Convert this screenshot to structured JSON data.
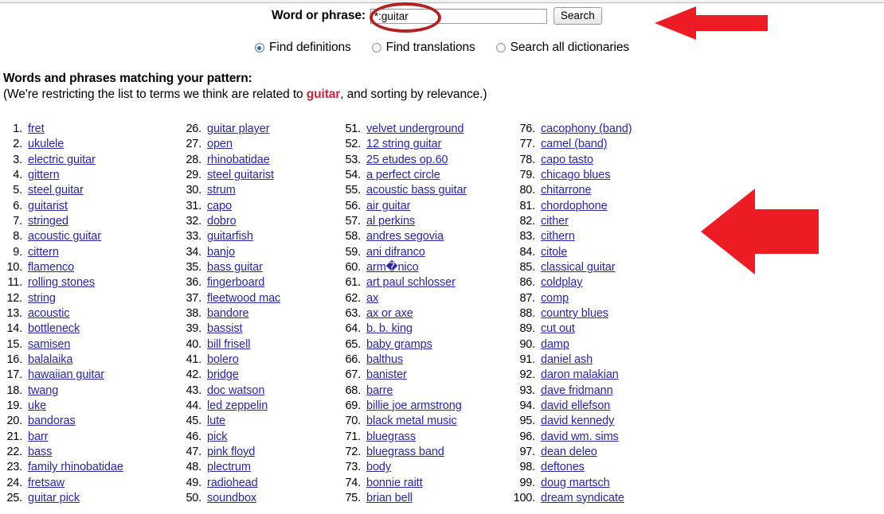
{
  "search": {
    "label": "Word or phrase:",
    "value": "*:guitar",
    "placeholder": "",
    "button_label": "Search"
  },
  "modes": [
    {
      "label": "Find definitions",
      "selected": true
    },
    {
      "label": "Find translations",
      "selected": false
    },
    {
      "label": "Search all dictionaries",
      "selected": false
    }
  ],
  "results": {
    "heading": "Words and phrases matching your pattern:",
    "note_prefix": "(We're restricting the list to terms we think are related to ",
    "note_keyword": "guitar",
    "note_suffix": ", and sorting by relevance.)",
    "columns": [
      {
        "items": [
          {
            "num": "1.",
            "label": "fret"
          },
          {
            "num": "2.",
            "label": "ukulele"
          },
          {
            "num": "3.",
            "label": "electric guitar"
          },
          {
            "num": "4.",
            "label": "gittern"
          },
          {
            "num": "5.",
            "label": "steel guitar"
          },
          {
            "num": "6.",
            "label": "guitarist"
          },
          {
            "num": "7.",
            "label": "stringed"
          },
          {
            "num": "8.",
            "label": "acoustic guitar"
          },
          {
            "num": "9.",
            "label": "cittern"
          },
          {
            "num": "10.",
            "label": "flamenco"
          },
          {
            "num": "11.",
            "label": "rolling stones"
          },
          {
            "num": "12.",
            "label": "string"
          },
          {
            "num": "13.",
            "label": "acoustic"
          },
          {
            "num": "14.",
            "label": "bottleneck"
          },
          {
            "num": "15.",
            "label": "samisen"
          },
          {
            "num": "16.",
            "label": "balalaika"
          },
          {
            "num": "17.",
            "label": "hawaiian guitar"
          },
          {
            "num": "18.",
            "label": "twang"
          },
          {
            "num": "19.",
            "label": "uke"
          },
          {
            "num": "20.",
            "label": "bandoras"
          },
          {
            "num": "21.",
            "label": "barr"
          },
          {
            "num": "22.",
            "label": "bass"
          },
          {
            "num": "23.",
            "label": "family rhinobatidae"
          },
          {
            "num": "24.",
            "label": "fretsaw"
          },
          {
            "num": "25.",
            "label": "guitar pick"
          }
        ]
      },
      {
        "items": [
          {
            "num": "26.",
            "label": "guitar player"
          },
          {
            "num": "27.",
            "label": "open"
          },
          {
            "num": "28.",
            "label": "rhinobatidae"
          },
          {
            "num": "29.",
            "label": "steel guitarist"
          },
          {
            "num": "30.",
            "label": "strum"
          },
          {
            "num": "31.",
            "label": "capo"
          },
          {
            "num": "32.",
            "label": "dobro"
          },
          {
            "num": "33.",
            "label": "guitarfish"
          },
          {
            "num": "34.",
            "label": "banjo"
          },
          {
            "num": "35.",
            "label": "bass guitar"
          },
          {
            "num": "36.",
            "label": "fingerboard"
          },
          {
            "num": "37.",
            "label": "fleetwood mac"
          },
          {
            "num": "38.",
            "label": "bandore"
          },
          {
            "num": "39.",
            "label": "bassist"
          },
          {
            "num": "40.",
            "label": "bill frisell"
          },
          {
            "num": "41.",
            "label": "bolero"
          },
          {
            "num": "42.",
            "label": "bridge"
          },
          {
            "num": "43.",
            "label": "doc watson"
          },
          {
            "num": "44.",
            "label": "led zeppelin"
          },
          {
            "num": "45.",
            "label": "lute"
          },
          {
            "num": "46.",
            "label": "pick"
          },
          {
            "num": "47.",
            "label": "pink floyd"
          },
          {
            "num": "48.",
            "label": "plectrum"
          },
          {
            "num": "49.",
            "label": "radiohead"
          },
          {
            "num": "50.",
            "label": "soundbox"
          }
        ]
      },
      {
        "items": [
          {
            "num": "51.",
            "label": "velvet underground"
          },
          {
            "num": "52.",
            "label": "12 string guitar"
          },
          {
            "num": "53.",
            "label": "25 etudes op.60"
          },
          {
            "num": "54.",
            "label": "a perfect circle"
          },
          {
            "num": "55.",
            "label": "acoustic bass guitar"
          },
          {
            "num": "56.",
            "label": "air guitar"
          },
          {
            "num": "57.",
            "label": "al perkins"
          },
          {
            "num": "58.",
            "label": "andres segovia"
          },
          {
            "num": "59.",
            "label": "ani difranco"
          },
          {
            "num": "60.",
            "label": "arm�nico"
          },
          {
            "num": "61.",
            "label": "art paul schlosser"
          },
          {
            "num": "62.",
            "label": "ax"
          },
          {
            "num": "63.",
            "label": "ax or axe"
          },
          {
            "num": "64.",
            "label": "b. b. king"
          },
          {
            "num": "65.",
            "label": "baby gramps"
          },
          {
            "num": "66.",
            "label": "balthus"
          },
          {
            "num": "67.",
            "label": "banister"
          },
          {
            "num": "68.",
            "label": "barre"
          },
          {
            "num": "69.",
            "label": "billie joe armstrong"
          },
          {
            "num": "70.",
            "label": "black metal music"
          },
          {
            "num": "71.",
            "label": "bluegrass"
          },
          {
            "num": "72.",
            "label": "bluegrass band"
          },
          {
            "num": "73.",
            "label": "body"
          },
          {
            "num": "74.",
            "label": "bonnie raitt"
          },
          {
            "num": "75.",
            "label": "brian bell"
          }
        ]
      },
      {
        "items": [
          {
            "num": "76.",
            "label": "cacophony (band)"
          },
          {
            "num": "77.",
            "label": "camel (band)"
          },
          {
            "num": "78.",
            "label": "capo tasto"
          },
          {
            "num": "79.",
            "label": "chicago blues"
          },
          {
            "num": "80.",
            "label": "chitarrone"
          },
          {
            "num": "81.",
            "label": "chordophone"
          },
          {
            "num": "82.",
            "label": "cither"
          },
          {
            "num": "83.",
            "label": "cithern"
          },
          {
            "num": "84.",
            "label": "citole"
          },
          {
            "num": "85.",
            "label": "classical guitar"
          },
          {
            "num": "86.",
            "label": "coldplay"
          },
          {
            "num": "87.",
            "label": "comp"
          },
          {
            "num": "88.",
            "label": "country blues"
          },
          {
            "num": "89.",
            "label": "cut out"
          },
          {
            "num": "90.",
            "label": "damp"
          },
          {
            "num": "91.",
            "label": "daniel ash"
          },
          {
            "num": "92.",
            "label": "daron malakian"
          },
          {
            "num": "93.",
            "label": "dave fridmann"
          },
          {
            "num": "94.",
            "label": "david ellefson"
          },
          {
            "num": "95.",
            "label": "david kennedy"
          },
          {
            "num": "96.",
            "label": "david wm. sims"
          },
          {
            "num": "97.",
            "label": "dean deleo"
          },
          {
            "num": "98.",
            "label": "deftones"
          },
          {
            "num": "99.",
            "label": "doug martsch"
          },
          {
            "num": "100.",
            "label": "dream syndicate"
          }
        ]
      }
    ]
  },
  "annotations": {
    "highlight_color": "#b22222",
    "arrow_color": "#ee1c25",
    "ellipse_target": "search-input",
    "arrow_1_target": "search-row",
    "arrow_2_target": "results-column-4"
  }
}
